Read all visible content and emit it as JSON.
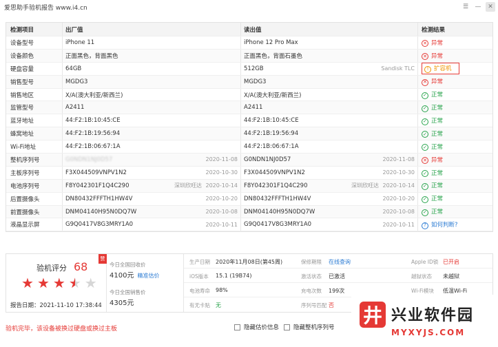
{
  "window": {
    "title": "爱思助手验机报告 www.i4.cn"
  },
  "table": {
    "headers": {
      "item": "检测项目",
      "factory": "出厂值",
      "read": "读出值",
      "result": "检测结果"
    },
    "rows": [
      {
        "item": "设备型号",
        "factory": "iPhone 11",
        "factory_date": "",
        "factory_extra": "",
        "read": "iPhone 12 Pro Max",
        "read_date": "",
        "read_extra": "",
        "result": "异常",
        "status": "bad"
      },
      {
        "item": "设备颜色",
        "factory": "正面黑色，背面黑色",
        "factory_date": "",
        "factory_extra": "",
        "read": "正面黑色，背面石墨色",
        "read_date": "",
        "read_extra": "",
        "result": "异常",
        "status": "bad"
      },
      {
        "item": "硬盘容量",
        "factory": "64GB",
        "factory_date": "",
        "factory_extra": "",
        "read": "512GB",
        "read_date": "",
        "read_extra": "Sandisk TLC",
        "result": "扩容机",
        "status": "warn"
      },
      {
        "item": "销售型号",
        "factory": "MGDG3",
        "factory_date": "",
        "factory_extra": "",
        "read": "MGDG3",
        "read_date": "",
        "read_extra": "",
        "result": "异常",
        "status": "bad"
      },
      {
        "item": "销售地区",
        "factory": "X/A(澳大利亚/新西兰)",
        "factory_date": "",
        "factory_extra": "",
        "read": "X/A(澳大利亚/新西兰)",
        "read_date": "",
        "read_extra": "",
        "result": "正常",
        "status": "ok"
      },
      {
        "item": "监管型号",
        "factory": "A2411",
        "factory_date": "",
        "factory_extra": "",
        "read": "A2411",
        "read_date": "",
        "read_extra": "",
        "result": "正常",
        "status": "ok"
      },
      {
        "item": "蓝牙地址",
        "factory": "44:F2:1B:10:45:CE",
        "factory_date": "",
        "factory_extra": "",
        "read": "44:F2:1B:10:45:CE",
        "read_date": "",
        "read_extra": "",
        "result": "正常",
        "status": "ok"
      },
      {
        "item": "蜂窝地址",
        "factory": "44:F2:1B:19:56:94",
        "factory_date": "",
        "factory_extra": "",
        "read": "44:F2:1B:19:56:94",
        "read_date": "",
        "read_extra": "",
        "result": "正常",
        "status": "ok"
      },
      {
        "item": "Wi-Fi地址",
        "factory": "44:F2:1B:06:67:1A",
        "factory_date": "",
        "factory_extra": "",
        "read": "44:F2:1B:06:67:1A",
        "read_date": "",
        "read_extra": "",
        "result": "正常",
        "status": "ok"
      },
      {
        "item": "整机序列号",
        "factory": "G0NDN1NJ0D57",
        "factory_date": "2020-11-08",
        "factory_extra": "",
        "read": "G0NDN1NJ0D57",
        "read_date": "2020-11-08",
        "read_extra": "",
        "result": "异常",
        "status": "bad"
      },
      {
        "item": "主板序列号",
        "factory": "F3X044509VNPV1N2",
        "factory_date": "2020-10-30",
        "factory_extra": "",
        "read": "F3X044509VNPV1N2",
        "read_date": "2020-10-30",
        "read_extra": "",
        "result": "正常",
        "status": "ok"
      },
      {
        "item": "电池序列号",
        "factory": "F8Y042301F1Q4C290",
        "factory_date": "2020-10-14",
        "factory_extra": "深圳欣旺达",
        "read": "F8Y042301F1Q4C290",
        "read_date": "2020-10-14",
        "read_extra": "深圳欣旺达",
        "result": "正常",
        "status": "ok"
      },
      {
        "item": "后置摄像头",
        "factory": "DN80432FFFTH1HW4V",
        "factory_date": "2020-10-20",
        "factory_extra": "",
        "read": "DN80432FFFTH1HW4V",
        "read_date": "2020-10-20",
        "read_extra": "",
        "result": "正常",
        "status": "ok"
      },
      {
        "item": "前置摄像头",
        "factory": "DNM04140H95N0DQ7W",
        "factory_date": "2020-10-08",
        "factory_extra": "",
        "read": "DNM04140H95N0DQ7W",
        "read_date": "2020-10-08",
        "read_extra": "",
        "result": "正常",
        "status": "ok"
      },
      {
        "item": "液晶显示屏",
        "factory": "G9Q0417V8G3MRY1A0",
        "factory_date": "2020-10-11",
        "factory_extra": "",
        "read": "G9Q0417V8G3MRY1A0",
        "read_date": "2020-10-11",
        "read_extra": "",
        "result": "如何判断?",
        "status": "ask"
      }
    ]
  },
  "summary": {
    "score_label": "验机评分",
    "score": "68",
    "tag": "赞",
    "stars": 3.5,
    "report_date": "报告日期：2021-11-10 17:38:44",
    "recycle_label": "今日全国回收价",
    "recycle_value": "4100元",
    "recycle_link": "精准估价",
    "sell_label": "今日全国销售价",
    "sell_value": "4305元",
    "info": [
      {
        "k": "生产日期",
        "v": "2020年11月08日(第45周)",
        "k2": "保修期限",
        "v2": "在线查询",
        "k3": "Apple ID锁",
        "v3": "已开启"
      },
      {
        "k": "iOS版本",
        "v": "15.1 (19B74)",
        "k2": "激活状态",
        "v2": "已激活",
        "k3": "越狱状态",
        "v3": "未越狱"
      },
      {
        "k": "电池寿命",
        "v": "98%",
        "k2": "充电次数",
        "v2": "199次",
        "k3": "Wi-Fi模块",
        "v3": "低温Wi-Fi"
      },
      {
        "k": "有无卡贴",
        "v": "无",
        "k2": "序列号匹配",
        "v2": "否",
        "k3": "",
        "v3": ""
      }
    ]
  },
  "footer": {
    "message": "验机完毕，该设备被换过硬盘或换过主板",
    "hide_price": "隐藏估价信息",
    "hide_serial": "隐藏整机序列号"
  },
  "watermark": {
    "logo": "井",
    "cn": "兴业软件园",
    "en": "MYXYJS.COM"
  },
  "colors": {
    "ok": "#27a34b",
    "bad": "#e53935",
    "warn": "#f09400",
    "link": "#2b7bd3"
  }
}
